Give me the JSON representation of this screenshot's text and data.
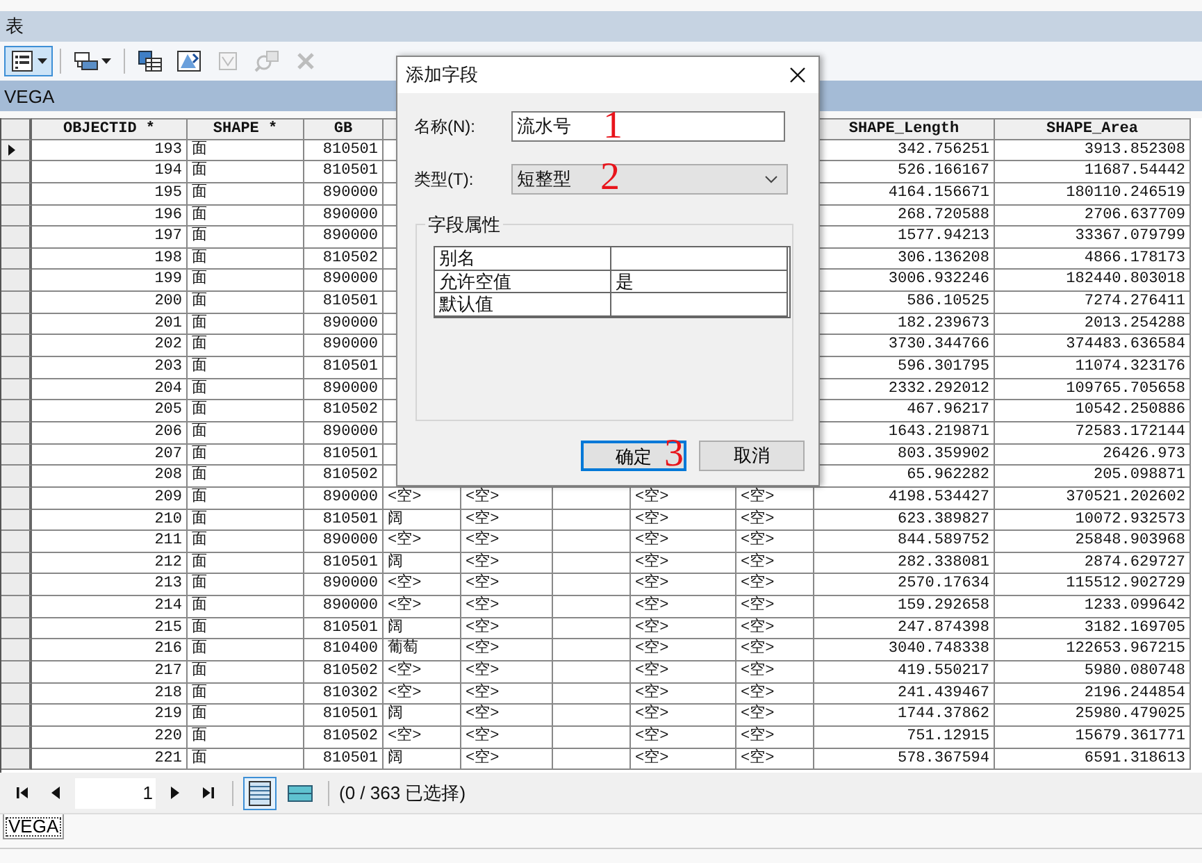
{
  "window": {
    "title": "表"
  },
  "toolbar": [
    {
      "kind": "table-options",
      "pressed": true,
      "disabled": false,
      "dropdown": true
    },
    {
      "kind": "related-tables",
      "pressed": false,
      "disabled": false,
      "dropdown": true
    },
    {
      "kind": "select-by-attributes",
      "pressed": false,
      "disabled": false,
      "dropdown": false
    },
    {
      "kind": "switch-selection",
      "pressed": false,
      "disabled": false,
      "dropdown": false
    },
    {
      "kind": "clear-selection",
      "pressed": false,
      "disabled": true,
      "dropdown": false
    },
    {
      "kind": "zoom-to",
      "pressed": false,
      "disabled": true,
      "dropdown": false
    },
    {
      "kind": "delete",
      "pressed": false,
      "disabled": true,
      "dropdown": false
    }
  ],
  "table": {
    "name": "VEGA",
    "headers": {
      "objectid": "OBJECTID *",
      "shape": "SHAPE *",
      "gb": "GB",
      "shape_length": "SHAPE_Length",
      "shape_area": "SHAPE_Area"
    },
    "rows": [
      {
        "current": true,
        "objectid": "193",
        "shape": "面",
        "gb": "810501",
        "shape_length": "342.756251",
        "shape_area": "3913.852308"
      },
      {
        "current": false,
        "objectid": "194",
        "shape": "面",
        "gb": "810501",
        "shape_length": "526.166167",
        "shape_area": "11687.54442"
      },
      {
        "current": false,
        "objectid": "195",
        "shape": "面",
        "gb": "890000",
        "shape_length": "4164.156671",
        "shape_area": "180110.246519"
      },
      {
        "current": false,
        "objectid": "196",
        "shape": "面",
        "gb": "890000",
        "shape_length": "268.720588",
        "shape_area": "2706.637709"
      },
      {
        "current": false,
        "objectid": "197",
        "shape": "面",
        "gb": "890000",
        "shape_length": "1577.94213",
        "shape_area": "33367.079799"
      },
      {
        "current": false,
        "objectid": "198",
        "shape": "面",
        "gb": "810502",
        "shape_length": "306.136208",
        "shape_area": "4866.178173"
      },
      {
        "current": false,
        "objectid": "199",
        "shape": "面",
        "gb": "890000",
        "shape_length": "3006.932246",
        "shape_area": "182440.803018"
      },
      {
        "current": false,
        "objectid": "200",
        "shape": "面",
        "gb": "810501",
        "shape_length": "586.10525",
        "shape_area": "7274.276411"
      },
      {
        "current": false,
        "objectid": "201",
        "shape": "面",
        "gb": "890000",
        "shape_length": "182.239673",
        "shape_area": "2013.254288"
      },
      {
        "current": false,
        "objectid": "202",
        "shape": "面",
        "gb": "890000",
        "shape_length": "3730.344766",
        "shape_area": "374483.636584"
      },
      {
        "current": false,
        "objectid": "203",
        "shape": "面",
        "gb": "810501",
        "shape_length": "596.301795",
        "shape_area": "11074.323176"
      },
      {
        "current": false,
        "objectid": "204",
        "shape": "面",
        "gb": "890000",
        "shape_length": "2332.292012",
        "shape_area": "109765.705658"
      },
      {
        "current": false,
        "objectid": "205",
        "shape": "面",
        "gb": "810502",
        "shape_length": "467.96217",
        "shape_area": "10542.250886"
      },
      {
        "current": false,
        "objectid": "206",
        "shape": "面",
        "gb": "890000",
        "shape_length": "1643.219871",
        "shape_area": "72583.172144"
      },
      {
        "current": false,
        "objectid": "207",
        "shape": "面",
        "gb": "810501",
        "shape_length": "803.359902",
        "shape_area": "26426.973"
      },
      {
        "current": false,
        "objectid": "208",
        "shape": "面",
        "gb": "810502",
        "shape_length": "65.962282",
        "shape_area": "205.098871"
      },
      {
        "current": false,
        "objectid": "209",
        "shape": "面",
        "gb": "890000",
        "column_4": "<空>",
        "column_5": "<空>",
        "column_7": "<空>",
        "column_8": "<空>",
        "shape_length": "4198.534427",
        "shape_area": "370521.202602"
      },
      {
        "current": false,
        "objectid": "210",
        "shape": "面",
        "gb": "810501",
        "column_4": "阔",
        "column_5": "<空>",
        "column_7": "<空>",
        "column_8": "<空>",
        "shape_length": "623.389827",
        "shape_area": "10072.932573"
      },
      {
        "current": false,
        "objectid": "211",
        "shape": "面",
        "gb": "890000",
        "column_4": "<空>",
        "column_5": "<空>",
        "column_7": "<空>",
        "column_8": "<空>",
        "shape_length": "844.589752",
        "shape_area": "25848.903968"
      },
      {
        "current": false,
        "objectid": "212",
        "shape": "面",
        "gb": "810501",
        "column_4": "阔",
        "column_5": "<空>",
        "column_7": "<空>",
        "column_8": "<空>",
        "shape_length": "282.338081",
        "shape_area": "2874.629727"
      },
      {
        "current": false,
        "objectid": "213",
        "shape": "面",
        "gb": "890000",
        "column_4": "<空>",
        "column_5": "<空>",
        "column_7": "<空>",
        "column_8": "<空>",
        "shape_length": "2570.17634",
        "shape_area": "115512.902729"
      },
      {
        "current": false,
        "objectid": "214",
        "shape": "面",
        "gb": "890000",
        "column_4": "<空>",
        "column_5": "<空>",
        "column_7": "<空>",
        "column_8": "<空>",
        "shape_length": "159.292658",
        "shape_area": "1233.099642"
      },
      {
        "current": false,
        "objectid": "215",
        "shape": "面",
        "gb": "810501",
        "column_4": "阔",
        "column_5": "<空>",
        "column_7": "<空>",
        "column_8": "<空>",
        "shape_length": "247.874398",
        "shape_area": "3182.169705"
      },
      {
        "current": false,
        "objectid": "216",
        "shape": "面",
        "gb": "810400",
        "column_4": "葡萄",
        "column_5": "<空>",
        "column_7": "<空>",
        "column_8": "<空>",
        "shape_length": "3040.748338",
        "shape_area": "122653.967215"
      },
      {
        "current": false,
        "objectid": "217",
        "shape": "面",
        "gb": "810502",
        "column_4": "<空>",
        "column_5": "<空>",
        "column_7": "<空>",
        "column_8": "<空>",
        "shape_length": "419.550217",
        "shape_area": "5980.080748"
      },
      {
        "current": false,
        "objectid": "218",
        "shape": "面",
        "gb": "810302",
        "column_4": "<空>",
        "column_5": "<空>",
        "column_7": "<空>",
        "column_8": "<空>",
        "shape_length": "241.439467",
        "shape_area": "2196.244854"
      },
      {
        "current": false,
        "objectid": "219",
        "shape": "面",
        "gb": "810501",
        "column_4": "阔",
        "column_5": "<空>",
        "column_7": "<空>",
        "column_8": "<空>",
        "shape_length": "1744.37862",
        "shape_area": "25980.479025"
      },
      {
        "current": false,
        "objectid": "220",
        "shape": "面",
        "gb": "810502",
        "column_4": "<空>",
        "column_5": "<空>",
        "column_7": "<空>",
        "column_8": "<空>",
        "shape_length": "751.12915",
        "shape_area": "15679.361771"
      },
      {
        "current": false,
        "objectid": "221",
        "shape": "面",
        "gb": "810501",
        "column_4": "阔",
        "column_5": "<空>",
        "column_7": "<空>",
        "column_8": "<空>",
        "shape_length": "578.367594",
        "shape_area": "6591.318613"
      }
    ]
  },
  "navigation": {
    "page": "1",
    "views": [
      {
        "kind": "all",
        "selected": true
      },
      {
        "kind": "selected",
        "selected": false
      }
    ],
    "status": "(0 / 363 已选择)"
  },
  "tabs": [
    {
      "label": "VEGA",
      "selected": true
    }
  ],
  "dialog": {
    "title": "添加字段",
    "name_label": "名称(N):",
    "name_value": "流水号",
    "type_label": "类型(T):",
    "type_value": "短整型",
    "group_title": "字段属性",
    "properties": [
      {
        "name": "别名"
      },
      {
        "name": "允许空值",
        "value": "是"
      },
      {
        "name": "默认值"
      }
    ],
    "buttons": [
      {
        "label": "确定",
        "focused": true
      },
      {
        "label": "取消",
        "focused": false
      }
    ],
    "markers": [
      "1",
      "2",
      "3"
    ]
  }
}
